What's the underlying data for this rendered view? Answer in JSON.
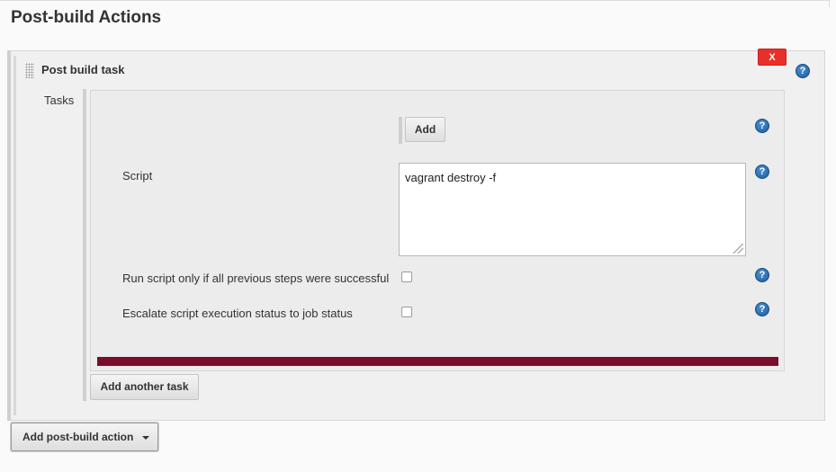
{
  "page": {
    "heading": "Post-build Actions"
  },
  "section": {
    "title": "Post build task",
    "delete_label": "X"
  },
  "tasks": {
    "label": "Tasks",
    "add_label": "Add",
    "script_label": "Script",
    "script_value": "vagrant destroy -f",
    "run_if_success_label": "Run script only if all previous steps were successful",
    "run_if_success_checked": false,
    "escalate_label": "Escalate script execution status to job status",
    "escalate_checked": false,
    "add_another_label": "Add another task"
  },
  "footer": {
    "add_post_build_label": "Add post-build action"
  },
  "help": {
    "glyph": "?"
  },
  "colors": {
    "delete_button": "#e8302b",
    "divider_bar": "#7a0d2c",
    "help_icon": "#1c5d9c"
  }
}
